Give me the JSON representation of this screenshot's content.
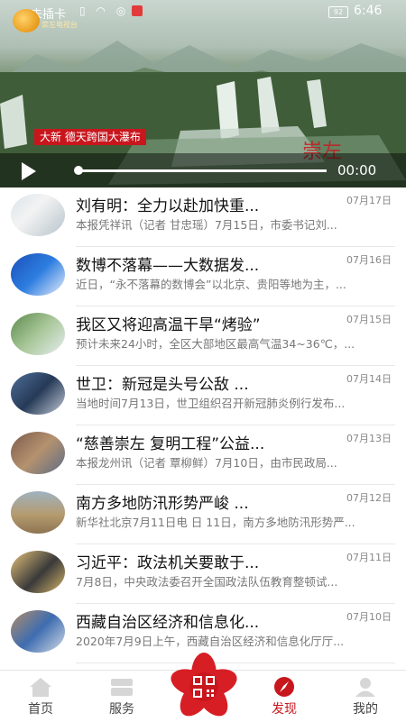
{
  "status": {
    "carrier": "未插卡",
    "battery": "92",
    "time": "6:46"
  },
  "video": {
    "logo_text": "崇左电视台",
    "caption": "大新 德天跨国大瀑布",
    "watermark": "崇左",
    "duration": "00:00",
    "progress": 0
  },
  "news": [
    {
      "title": "刘有明：全力以赴加快重...",
      "date": "07月17日",
      "summary": "本报凭祥讯（记者 甘忠瑶）7月15日，市委书记刘..."
    },
    {
      "title": "数博不落幕——大数据发...",
      "date": "07月16日",
      "summary": "近日，“永不落幕的数博会”以北京、贵阳等地为主，..."
    },
    {
      "title": "我区又将迎高温干旱“烤验”",
      "date": "07月15日",
      "summary": "预计未来24小时，全区大部地区最高气温34~36℃，..."
    },
    {
      "title": "世卫：新冠是头号公敌 ...",
      "date": "07月14日",
      "summary": "当地时间7月13日，世卫组织召开新冠肺炎例行发布..."
    },
    {
      "title": "“慈善崇左 复明工程”公益...",
      "date": "07月13日",
      "summary": "本报龙州讯（记者 覃柳鲜）7月10日，由市民政局..."
    },
    {
      "title": "南方多地防汛形势严峻 ...",
      "date": "07月12日",
      "summary": "新华社北京7月11日电 日 11日，南方多地防汛形势严..."
    },
    {
      "title": "习近平：政法机关要敢于...",
      "date": "07月11日",
      "summary": "7月8日，中央政法委召开全国政法队伍教育整顿试..."
    },
    {
      "title": "西藏自治区经济和信息化...",
      "date": "07月10日",
      "summary": "2020年7月9日上午，西藏自治区经济和信息化厅厅..."
    }
  ],
  "tabs": [
    {
      "label": "首页",
      "icon": "home-icon"
    },
    {
      "label": "服务",
      "icon": "service-icon"
    },
    {
      "label": "发现",
      "icon": "compass-icon",
      "active": true
    },
    {
      "label": "我的",
      "icon": "user-icon"
    }
  ],
  "colors": {
    "accent": "#c8161d",
    "text": "#111111",
    "muted": "#777777"
  }
}
